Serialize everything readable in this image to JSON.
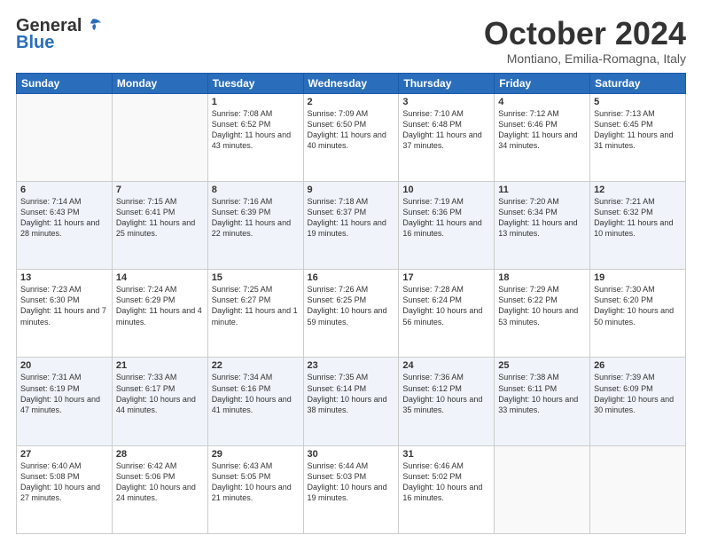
{
  "header": {
    "logo_general": "General",
    "logo_blue": "Blue",
    "month_title": "October 2024",
    "location": "Montiano, Emilia-Romagna, Italy"
  },
  "weekdays": [
    "Sunday",
    "Monday",
    "Tuesday",
    "Wednesday",
    "Thursday",
    "Friday",
    "Saturday"
  ],
  "weeks": [
    [
      {
        "day": "",
        "info": ""
      },
      {
        "day": "",
        "info": ""
      },
      {
        "day": "1",
        "info": "Sunrise: 7:08 AM\nSunset: 6:52 PM\nDaylight: 11 hours and 43 minutes."
      },
      {
        "day": "2",
        "info": "Sunrise: 7:09 AM\nSunset: 6:50 PM\nDaylight: 11 hours and 40 minutes."
      },
      {
        "day": "3",
        "info": "Sunrise: 7:10 AM\nSunset: 6:48 PM\nDaylight: 11 hours and 37 minutes."
      },
      {
        "day": "4",
        "info": "Sunrise: 7:12 AM\nSunset: 6:46 PM\nDaylight: 11 hours and 34 minutes."
      },
      {
        "day": "5",
        "info": "Sunrise: 7:13 AM\nSunset: 6:45 PM\nDaylight: 11 hours and 31 minutes."
      }
    ],
    [
      {
        "day": "6",
        "info": "Sunrise: 7:14 AM\nSunset: 6:43 PM\nDaylight: 11 hours and 28 minutes."
      },
      {
        "day": "7",
        "info": "Sunrise: 7:15 AM\nSunset: 6:41 PM\nDaylight: 11 hours and 25 minutes."
      },
      {
        "day": "8",
        "info": "Sunrise: 7:16 AM\nSunset: 6:39 PM\nDaylight: 11 hours and 22 minutes."
      },
      {
        "day": "9",
        "info": "Sunrise: 7:18 AM\nSunset: 6:37 PM\nDaylight: 11 hours and 19 minutes."
      },
      {
        "day": "10",
        "info": "Sunrise: 7:19 AM\nSunset: 6:36 PM\nDaylight: 11 hours and 16 minutes."
      },
      {
        "day": "11",
        "info": "Sunrise: 7:20 AM\nSunset: 6:34 PM\nDaylight: 11 hours and 13 minutes."
      },
      {
        "day": "12",
        "info": "Sunrise: 7:21 AM\nSunset: 6:32 PM\nDaylight: 11 hours and 10 minutes."
      }
    ],
    [
      {
        "day": "13",
        "info": "Sunrise: 7:23 AM\nSunset: 6:30 PM\nDaylight: 11 hours and 7 minutes."
      },
      {
        "day": "14",
        "info": "Sunrise: 7:24 AM\nSunset: 6:29 PM\nDaylight: 11 hours and 4 minutes."
      },
      {
        "day": "15",
        "info": "Sunrise: 7:25 AM\nSunset: 6:27 PM\nDaylight: 11 hours and 1 minute."
      },
      {
        "day": "16",
        "info": "Sunrise: 7:26 AM\nSunset: 6:25 PM\nDaylight: 10 hours and 59 minutes."
      },
      {
        "day": "17",
        "info": "Sunrise: 7:28 AM\nSunset: 6:24 PM\nDaylight: 10 hours and 56 minutes."
      },
      {
        "day": "18",
        "info": "Sunrise: 7:29 AM\nSunset: 6:22 PM\nDaylight: 10 hours and 53 minutes."
      },
      {
        "day": "19",
        "info": "Sunrise: 7:30 AM\nSunset: 6:20 PM\nDaylight: 10 hours and 50 minutes."
      }
    ],
    [
      {
        "day": "20",
        "info": "Sunrise: 7:31 AM\nSunset: 6:19 PM\nDaylight: 10 hours and 47 minutes."
      },
      {
        "day": "21",
        "info": "Sunrise: 7:33 AM\nSunset: 6:17 PM\nDaylight: 10 hours and 44 minutes."
      },
      {
        "day": "22",
        "info": "Sunrise: 7:34 AM\nSunset: 6:16 PM\nDaylight: 10 hours and 41 minutes."
      },
      {
        "day": "23",
        "info": "Sunrise: 7:35 AM\nSunset: 6:14 PM\nDaylight: 10 hours and 38 minutes."
      },
      {
        "day": "24",
        "info": "Sunrise: 7:36 AM\nSunset: 6:12 PM\nDaylight: 10 hours and 35 minutes."
      },
      {
        "day": "25",
        "info": "Sunrise: 7:38 AM\nSunset: 6:11 PM\nDaylight: 10 hours and 33 minutes."
      },
      {
        "day": "26",
        "info": "Sunrise: 7:39 AM\nSunset: 6:09 PM\nDaylight: 10 hours and 30 minutes."
      }
    ],
    [
      {
        "day": "27",
        "info": "Sunrise: 6:40 AM\nSunset: 5:08 PM\nDaylight: 10 hours and 27 minutes."
      },
      {
        "day": "28",
        "info": "Sunrise: 6:42 AM\nSunset: 5:06 PM\nDaylight: 10 hours and 24 minutes."
      },
      {
        "day": "29",
        "info": "Sunrise: 6:43 AM\nSunset: 5:05 PM\nDaylight: 10 hours and 21 minutes."
      },
      {
        "day": "30",
        "info": "Sunrise: 6:44 AM\nSunset: 5:03 PM\nDaylight: 10 hours and 19 minutes."
      },
      {
        "day": "31",
        "info": "Sunrise: 6:46 AM\nSunset: 5:02 PM\nDaylight: 10 hours and 16 minutes."
      },
      {
        "day": "",
        "info": ""
      },
      {
        "day": "",
        "info": ""
      }
    ]
  ]
}
